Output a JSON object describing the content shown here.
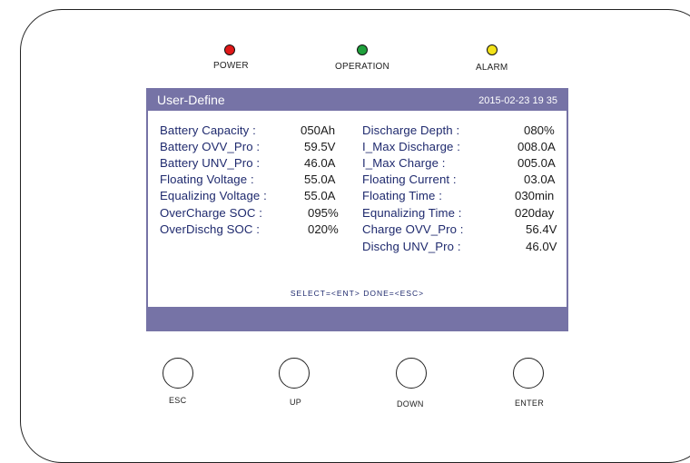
{
  "indicators": [
    {
      "label": "POWER",
      "color": "#e01818"
    },
    {
      "label": "OPERATION",
      "color": "#1fa03c"
    },
    {
      "label": "ALARM",
      "color": "#f2e21a"
    }
  ],
  "screen": {
    "title": "User-Define",
    "datetime": "2015-02-23  19 35",
    "header_color": "#7673a6",
    "left": [
      {
        "label": "Battery Capacity :",
        "value": "050Ah"
      },
      {
        "label": "Battery OVV_Pro :",
        "value": "59.5V"
      },
      {
        "label": "Battery UNV_Pro :",
        "value": "46.0A"
      },
      {
        "label": "Floating Voltage :",
        "value": "55.0A"
      },
      {
        "label": "Equalizing Voltage :",
        "value": "55.0A"
      },
      {
        "label": "OverCharge SOC :",
        "value": "095%"
      },
      {
        "label": "OverDischg SOC :",
        "value": "020%"
      }
    ],
    "right": [
      {
        "label": "Discharge Depth :",
        "value": "080%"
      },
      {
        "label": "I_Max Discharge :",
        "value": "008.0A"
      },
      {
        "label": "I_Max Charge :",
        "value": "005.0A"
      },
      {
        "label": "Floating Current :",
        "value": "03.0A"
      },
      {
        "label": "Floating Time :",
        "value": "030min"
      },
      {
        "label": "Equnalizing Time :",
        "value": "020day"
      },
      {
        "label": "Charge OVV_Pro :",
        "value": "56.4V"
      },
      {
        "label": "Dischg UNV_Pro :",
        "value": "46.0V"
      }
    ],
    "hint": "SELECT=<ENT>  DONE=<ESC>"
  },
  "buttons": [
    {
      "label": "ESC"
    },
    {
      "label": "UP"
    },
    {
      "label": "DOWN"
    },
    {
      "label": "ENTER"
    }
  ]
}
